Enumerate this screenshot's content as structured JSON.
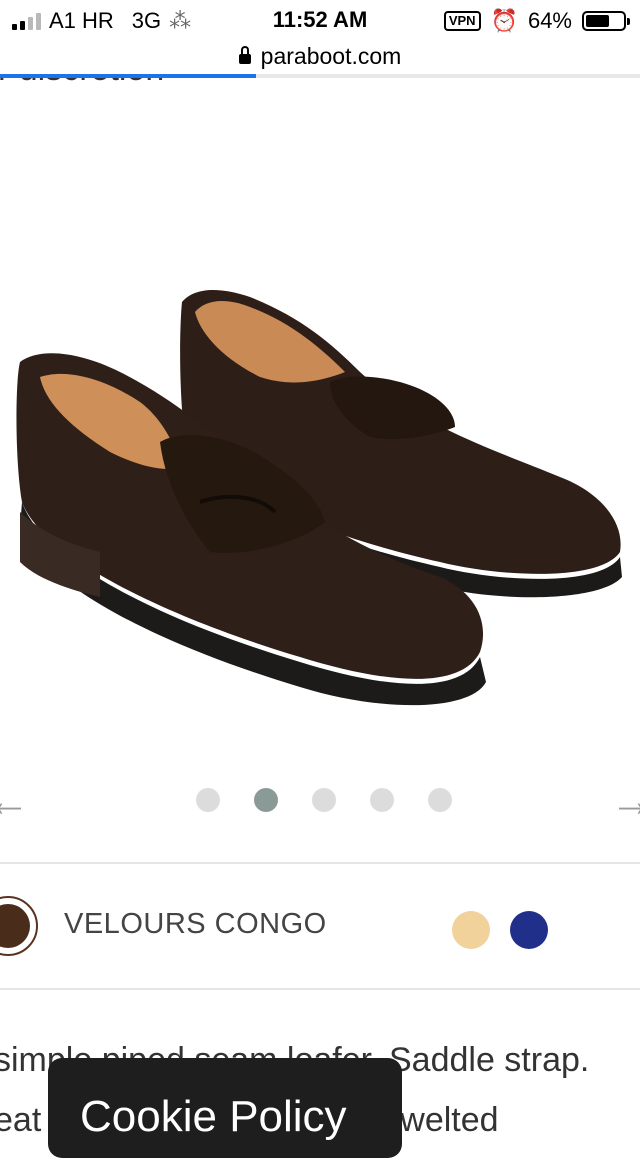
{
  "status_bar": {
    "carrier": "A1 HR",
    "network": "3G",
    "time": "11:52 AM",
    "vpn": "VPN",
    "battery": "64%",
    "battery_level": 0.64
  },
  "browser": {
    "url": "paraboot.com",
    "load_progress": 0.4
  },
  "top_partial_text": "r discretion",
  "product_image": {
    "alt": "Paraboot brown suede penny loafers"
  },
  "carousel": {
    "slide_count": 5,
    "active_index": 1
  },
  "colors": {
    "selected_name": "VELOURS CONGO",
    "selected_hex": "#4a2c1a",
    "options": [
      {
        "hex": "#f0d29a"
      },
      {
        "hex": "#1f2f8a"
      }
    ]
  },
  "description": {
    "line1": "simple piped seam loafer. Saddle strap.",
    "line2": "eat                          odyear welted"
  },
  "cookie_banner": {
    "title": "Cookie Policy"
  }
}
